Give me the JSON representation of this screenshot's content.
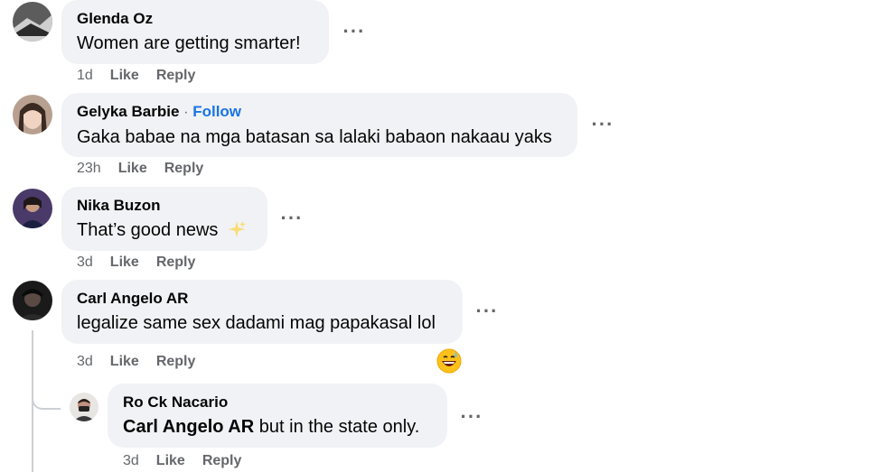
{
  "comments": [
    {
      "author": "Glenda Oz",
      "text": "Women are getting smarter!",
      "time": "1d",
      "like": "Like",
      "reply": "Reply"
    },
    {
      "author": "Gelyka Barbie",
      "follow_sep": "·",
      "follow": "Follow",
      "text": "Gaka babae na mga batasan sa lalaki babaon nakaau yaks",
      "time": "23h",
      "like": "Like",
      "reply": "Reply"
    },
    {
      "author": "Nika Buzon",
      "text": "That’s good news",
      "emoji": "sparkles-emoji",
      "time": "3d",
      "like": "Like",
      "reply": "Reply"
    },
    {
      "author": "Carl Angelo AR",
      "text": "legalize same sex dadami mag papakasal lol",
      "reaction": "grinning-sweat-emoji",
      "time": "3d",
      "like": "Like",
      "reply": "Reply"
    }
  ],
  "reply": {
    "author": "Ro Ck Nacario",
    "mention": "Carl Angelo AR",
    "text": " but in the state only.",
    "time": "3d",
    "like": "Like",
    "reply": "Reply"
  },
  "colors": {
    "bubble": "#f0f2f5",
    "muted": "#65676b",
    "link": "#1b74e4",
    "line": "#ccd0d5"
  },
  "icons": {
    "more": "more-dots-icon"
  }
}
